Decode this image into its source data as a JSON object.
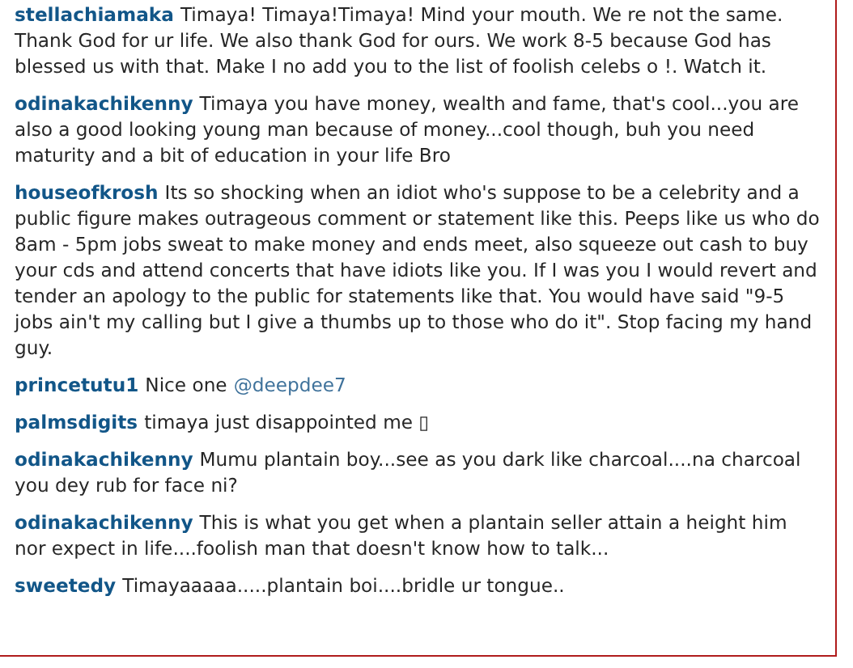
{
  "comments": [
    {
      "user": "stellachiamaka",
      "text": "Timaya! Timaya!Timaya! Mind your mouth. We re not the same. Thank God for ur life. We also thank God for ours. We work 8-5 because God has blessed us with that. Make I no add you to the list of foolish celebs o !. Watch it."
    },
    {
      "user": "odinakachikenny",
      "text": "Timaya you have money, wealth and fame, that's cool...you are also a good looking young man because of money...cool though, buh you need maturity and a bit of education in your life Bro"
    },
    {
      "user": "houseofkrosh",
      "text": "Its so shocking when an idiot who's suppose to be a celebrity and a public figure makes outrageous comment or statement like this. Peeps like us who do 8am - 5pm jobs sweat to make money and ends meet, also squeeze out cash to buy your cds and attend concerts that have idiots like you. If I was you I would revert and tender an apology to the public for statements like that. You would have said \"9-5 jobs ain't my calling but I give a thumbs up to those who do it\". Stop facing my hand guy."
    },
    {
      "user": "princetutu1",
      "text": "Nice one",
      "mention": "@deepdee7"
    },
    {
      "user": "palmsdigits",
      "text": "timaya just disappointed me ▯"
    },
    {
      "user": "odinakachikenny",
      "text": "Mumu plantain boy...see as you dark like charcoal....na charcoal you dey rub for face ni?"
    },
    {
      "user": "odinakachikenny",
      "text": "This is what you get when a plantain seller attain a height him nor expect in life....foolish man that doesn't know how to talk..."
    },
    {
      "user": "sweetedy",
      "text": "Timayaaaaa.....plantain boi....bridle ur tongue.."
    }
  ]
}
